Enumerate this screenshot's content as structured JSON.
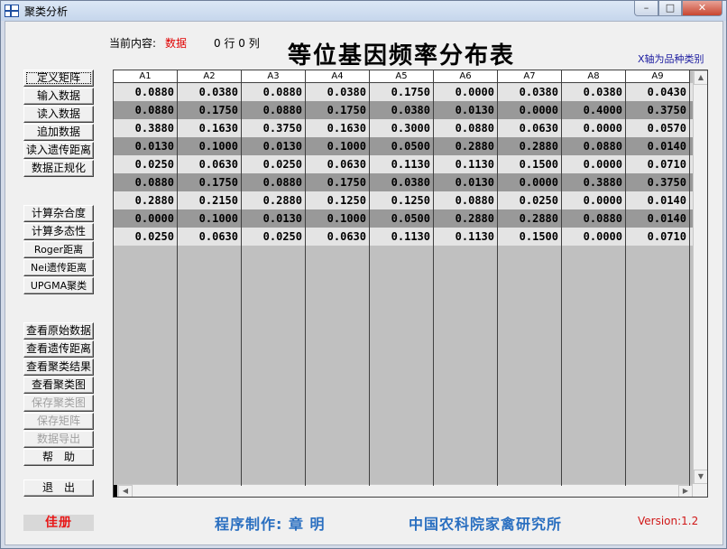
{
  "window": {
    "title": "聚类分析",
    "controls": {
      "minimize": "–",
      "maximize": "□",
      "close": "✕"
    }
  },
  "header": {
    "current_label": "当前内容:",
    "current_value": "数据",
    "rows_cols": "0  行 0  列",
    "title": "等位基因频率分布表",
    "axis_note": "X轴为品种类别"
  },
  "buttons": {
    "define_matrix": "定义矩阵",
    "input_data": "输入数据",
    "read_data": "读入数据",
    "append_data": "追加数据",
    "read_genetic_distance": "读入遗传距离",
    "normalize_data": "数据正规化",
    "calc_heterozygosity": "计算杂合度",
    "calc_polymorphism": "计算多态性",
    "roger_distance": "Roger距离",
    "nei_distance": "Nei遗传距离",
    "upgma": "UPGMA聚类",
    "view_raw_data": "查看原始数据",
    "view_genetic_distance": "查看遗传距离",
    "view_cluster_result": "查看聚类结果",
    "view_cluster_chart": "查看聚类图",
    "save_cluster_chart": "保存聚类图",
    "save_matrix": "保存矩阵",
    "export_data": "数据导出",
    "help": "帮　助",
    "exit": "退　出"
  },
  "grid": {
    "columns": [
      "A1",
      "A2",
      "A3",
      "A4",
      "A5",
      "A6",
      "A7",
      "A8",
      "A9"
    ],
    "rows": [
      [
        "0.0880",
        "0.0380",
        "0.0880",
        "0.0380",
        "0.1750",
        "0.0000",
        "0.0380",
        "0.0380",
        "0.0430"
      ],
      [
        "0.0880",
        "0.1750",
        "0.0880",
        "0.1750",
        "0.0380",
        "0.0130",
        "0.0000",
        "0.4000",
        "0.3750"
      ],
      [
        "0.3880",
        "0.1630",
        "0.3750",
        "0.1630",
        "0.3000",
        "0.0880",
        "0.0630",
        "0.0000",
        "0.0570"
      ],
      [
        "0.0130",
        "0.1000",
        "0.0130",
        "0.1000",
        "0.0500",
        "0.2880",
        "0.2880",
        "0.0880",
        "0.0140"
      ],
      [
        "0.0250",
        "0.0630",
        "0.0250",
        "0.0630",
        "0.1130",
        "0.1130",
        "0.1500",
        "0.0000",
        "0.0710"
      ],
      [
        "0.0880",
        "0.1750",
        "0.0880",
        "0.1750",
        "0.0380",
        "0.0130",
        "0.0000",
        "0.3880",
        "0.3750"
      ],
      [
        "0.2880",
        "0.2150",
        "0.2880",
        "0.1250",
        "0.1250",
        "0.0880",
        "0.0250",
        "0.0000",
        "0.0140"
      ],
      [
        "0.0000",
        "0.1000",
        "0.0130",
        "0.1000",
        "0.0500",
        "0.2880",
        "0.2880",
        "0.0880",
        "0.0140"
      ],
      [
        "0.0250",
        "0.0630",
        "0.0250",
        "0.0630",
        "0.1130",
        "0.1130",
        "0.1500",
        "0.0000",
        "0.0710"
      ]
    ],
    "scroll_up": "▲",
    "scroll_down": "▼",
    "scroll_left": "◀",
    "scroll_right": "▶"
  },
  "footer": {
    "logo": "佳册",
    "credit": "程序制作: 章  明",
    "institute": "中国农科院家禽研究所",
    "version": "Version:1.2"
  }
}
